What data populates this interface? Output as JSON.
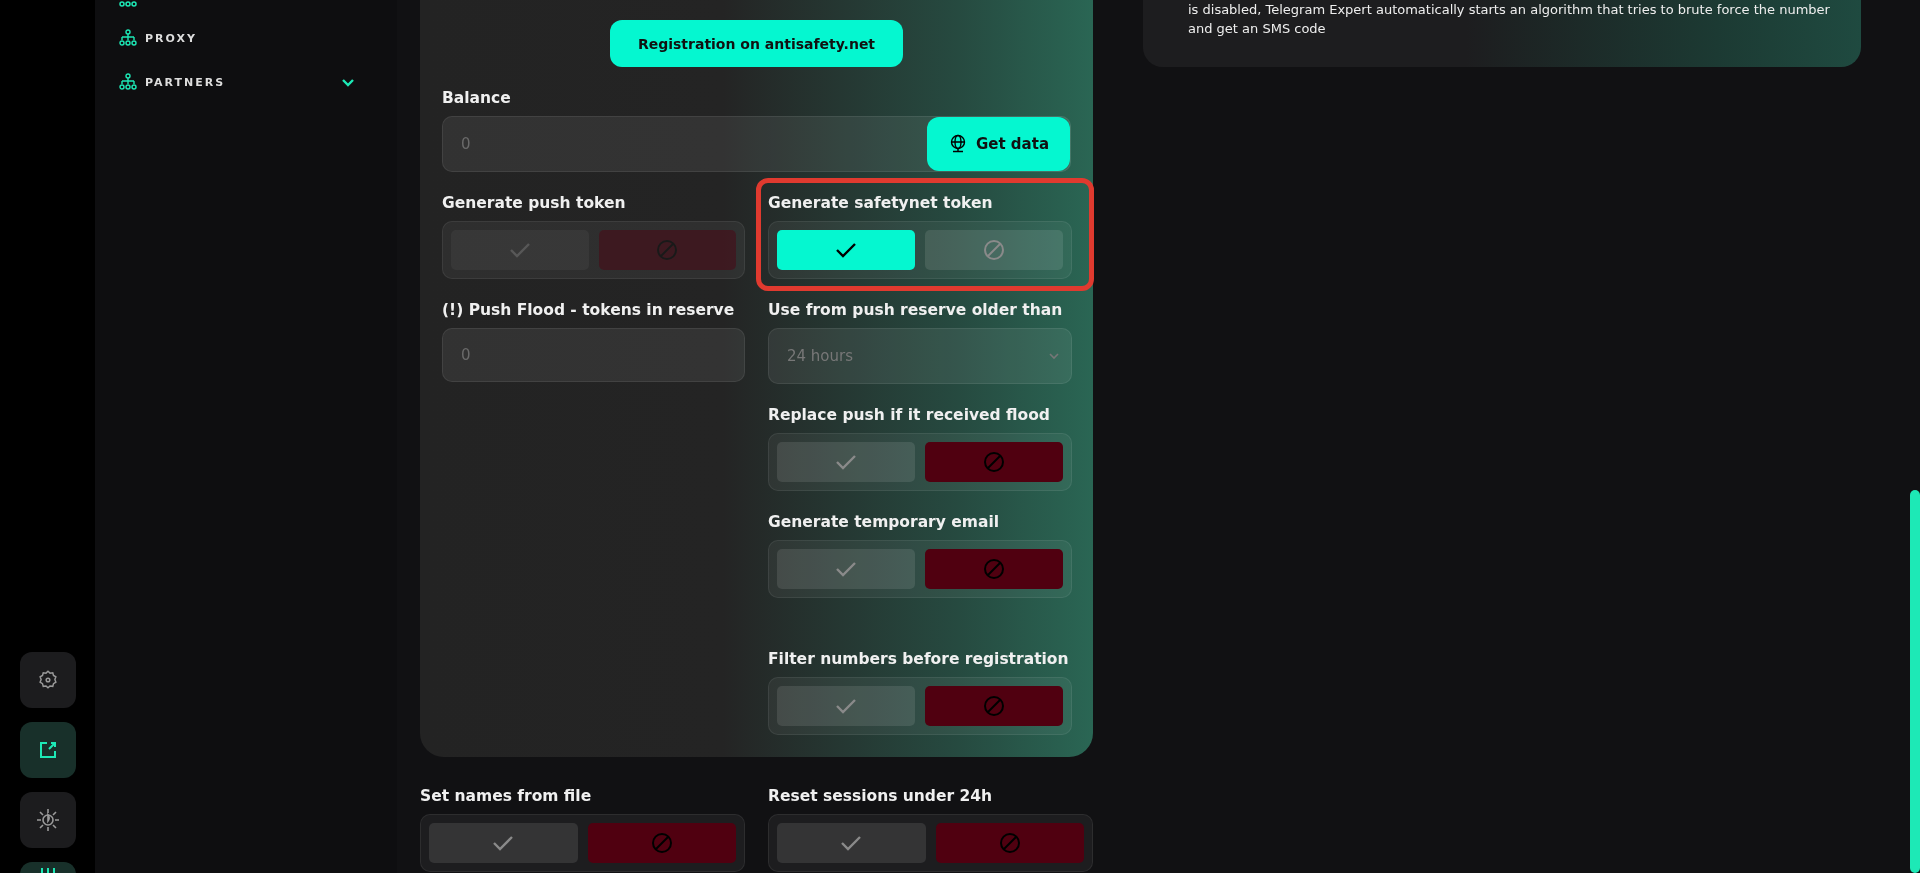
{
  "rail": [
    {
      "kind": "settings",
      "selected": false
    },
    {
      "kind": "external",
      "selected": true
    },
    {
      "kind": "theme",
      "selected": false
    },
    {
      "kind": "columns",
      "selected": true
    }
  ],
  "sidebar": {
    "items": [
      {
        "label": "PROXY",
        "expandable": false
      },
      {
        "label": "PARTNERS",
        "expandable": true
      }
    ]
  },
  "form": {
    "register_button": "Registration on antisafety.net",
    "balance": {
      "label": "Balance",
      "placeholder": "0",
      "button": "Get data"
    },
    "rows": [
      [
        {
          "kind": "toggle",
          "label": "Generate push token",
          "value": false,
          "disabled": true,
          "highlighted": false
        },
        {
          "kind": "toggle",
          "label": "Generate safetynet token",
          "value": true,
          "disabled": false,
          "highlighted": true
        }
      ],
      [
        {
          "kind": "input",
          "label": "(!) Push Flood - tokens in reserve",
          "placeholder": "0"
        },
        {
          "kind": "select",
          "label": "Use from push reserve older than",
          "value": "24 hours"
        }
      ],
      [
        {
          "kind": "empty"
        },
        {
          "kind": "toggle",
          "label": "Replace push if it received flood",
          "value": false,
          "disabled": false,
          "highlighted": false
        }
      ],
      [
        {
          "kind": "empty"
        },
        {
          "kind": "toggle",
          "label": "Generate temporary email",
          "value": false,
          "disabled": false,
          "highlighted": false
        }
      ],
      [
        {
          "kind": "empty"
        },
        {
          "kind": "toggle",
          "label": "Filter numbers before registration",
          "value": false,
          "disabled": false,
          "highlighted": false
        }
      ]
    ]
  },
  "below": [
    {
      "label": "Set names from file",
      "value": false
    },
    {
      "label": "Reset sessions under 24h",
      "value": false
    }
  ],
  "info": {
    "text": "is disabled, Telegram Expert automatically starts an algorithm that tries to brute force the number and get an SMS code"
  }
}
